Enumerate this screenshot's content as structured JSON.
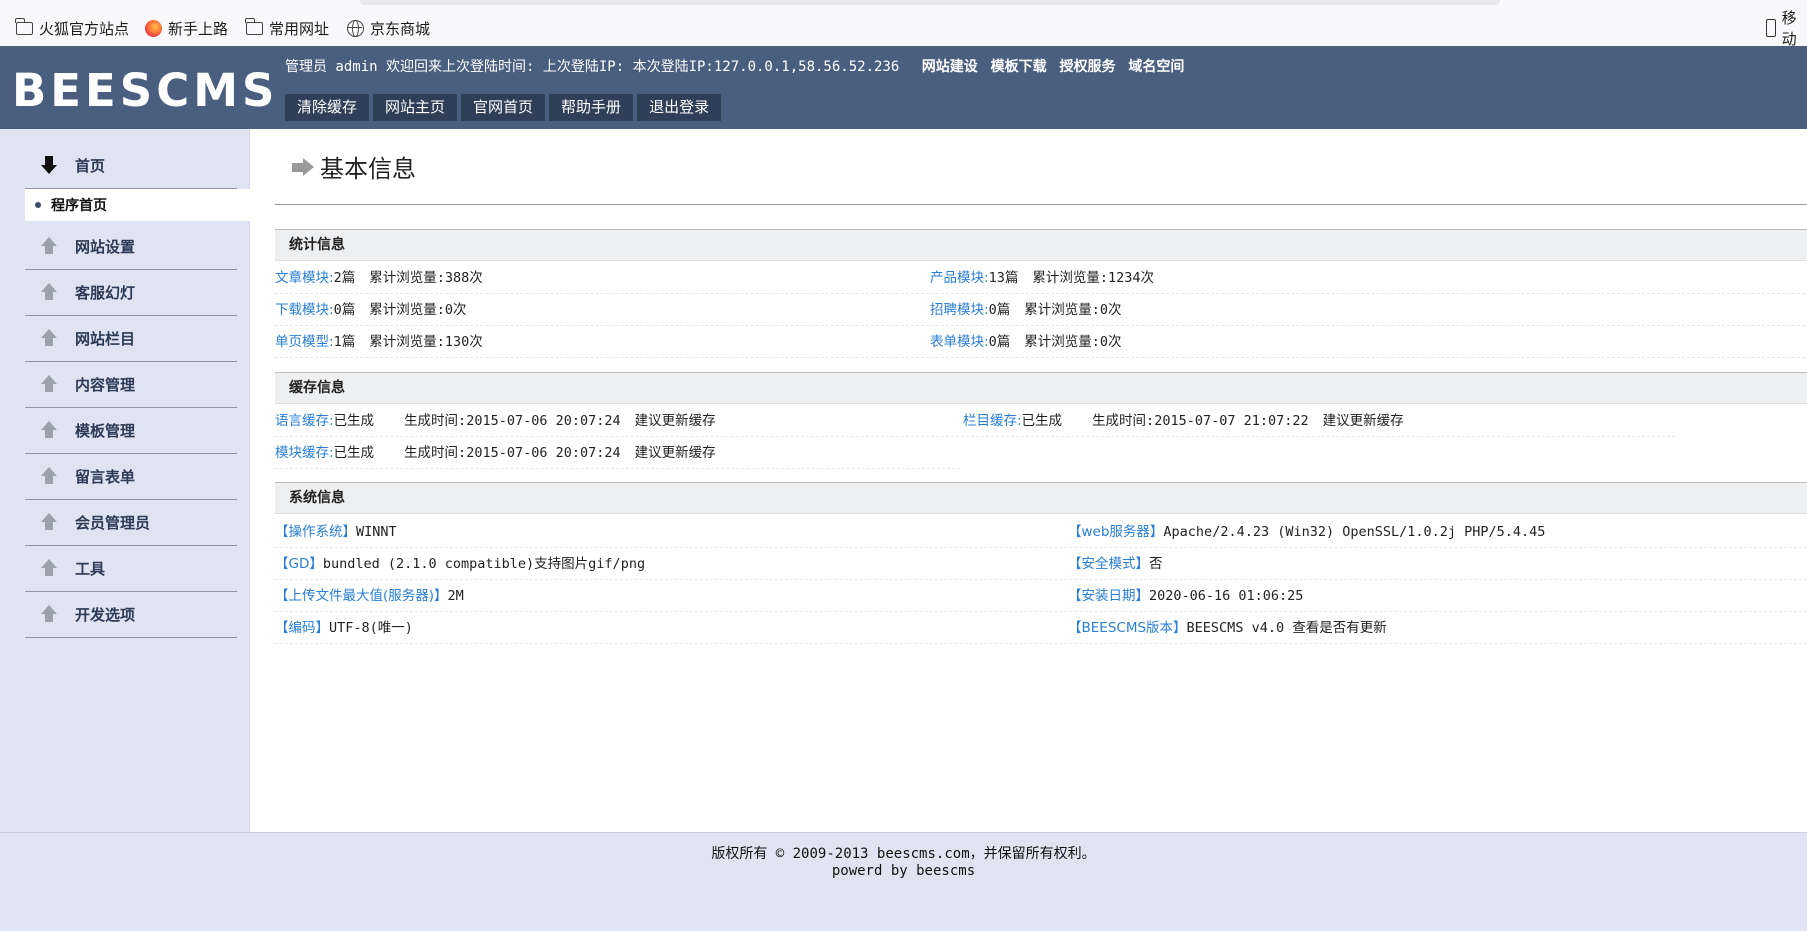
{
  "bookmarks": [
    {
      "label": "火狐官方站点",
      "icon": "folder-icon"
    },
    {
      "label": "新手上路",
      "icon": "firefox-icon"
    },
    {
      "label": "常用网址",
      "icon": "folder-icon"
    },
    {
      "label": "京东商城",
      "icon": "globe-icon"
    }
  ],
  "bookmarks_right": "移动",
  "header": {
    "logo": "BEESCMS",
    "user_info": "管理员 admin 欢迎回来上次登陆时间: 上次登陆IP: 本次登陆IP:127.0.0.1,58.56.52.236",
    "links": [
      "网站建设",
      "模板下载",
      "授权服务",
      "域名空间"
    ],
    "buttons": [
      "清除缓存",
      "网站主页",
      "官网首页",
      "帮助手册",
      "退出登录"
    ]
  },
  "sidebar": {
    "home": "首页",
    "active_sub": "程序首页",
    "items": [
      "网站设置",
      "客服幻灯",
      "网站栏目",
      "内容管理",
      "模板管理",
      "留言表单",
      "会员管理员",
      "工具",
      "开发选项"
    ]
  },
  "main": {
    "title": "基本信息",
    "stats": {
      "heading": "统计信息",
      "rows": [
        {
          "k1": "文章模块:",
          "v1": "2篇",
          "c1": "累计浏览量:388次",
          "k2": "产品模块:",
          "v2": "13篇",
          "c2": "累计浏览量:1234次"
        },
        {
          "k1": "下载模块:",
          "v1": "0篇",
          "c1": "累计浏览量:0次",
          "k2": "招聘模块:",
          "v2": "0篇",
          "c2": "累计浏览量:0次"
        },
        {
          "k1": "单页模型:",
          "v1": "1篇",
          "c1": "累计浏览量:130次",
          "k2": "表单模块:",
          "v2": "0篇",
          "c2": "累计浏览量:0次"
        }
      ]
    },
    "cache": {
      "heading": "缓存信息",
      "rows": [
        {
          "k1": "语言缓存:",
          "v1": "已生成",
          "t1": "生成时间:2015-07-06 20:07:24",
          "a1": "建议更新缓存",
          "k2": "栏目缓存:",
          "v2": "已生成",
          "t2": "生成时间:2015-07-07 21:07:22",
          "a2": "建议更新缓存"
        },
        {
          "k1": "模块缓存:",
          "v1": "已生成",
          "t1": "生成时间:2015-07-06 20:07:24",
          "a1": "建议更新缓存"
        }
      ]
    },
    "system": {
      "heading": "系统信息",
      "rows": [
        {
          "k1": "【操作系统】",
          "v1": "WINNT",
          "k2": "【web服务器】",
          "v2": "Apache/2.4.23 (Win32) OpenSSL/1.0.2j PHP/5.4.45"
        },
        {
          "k1": "【GD】",
          "v1": "bundled (2.1.0 compatible)支持图片gif/png",
          "k2": "【安全模式】",
          "v2": "否"
        },
        {
          "k1": "【上传文件最大值(服务器)】",
          "v1": "2M",
          "k2": "【安装日期】",
          "v2": "2020-06-16 01:06:25"
        },
        {
          "k1": "【编码】",
          "v1": "UTF-8(唯一)",
          "k2": "【BEESCMS版本】",
          "v2": "BEESCMS v4.0  查看是否有更新"
        }
      ]
    }
  },
  "footer": {
    "line1": "版权所有 © 2009-2013 beescms.com，并保留所有权利。",
    "line2": "powerd by beescms"
  }
}
